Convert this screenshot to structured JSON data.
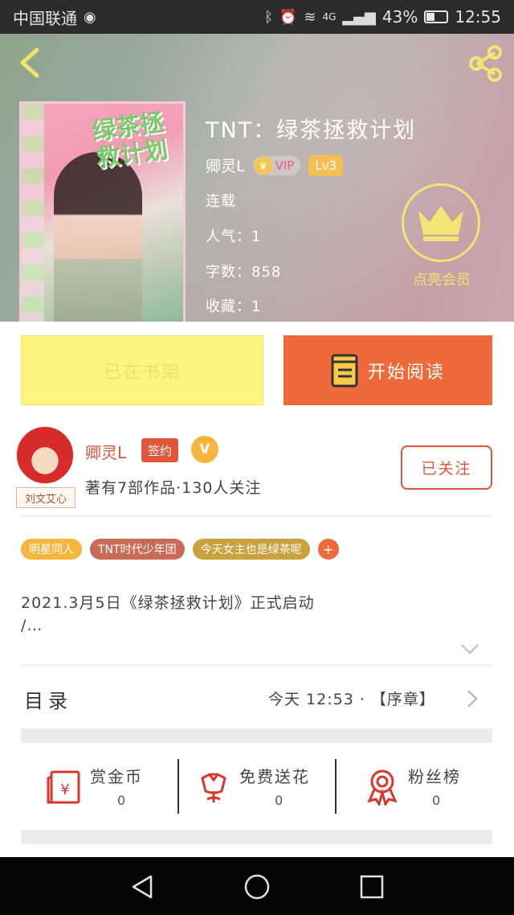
{
  "status_bar": {
    "carrier": "中国联通",
    "network": "4G",
    "battery_text": "43%",
    "battery_level": 0.43,
    "time": "12:55"
  },
  "header": {
    "back_icon": "chevron-left-icon",
    "share_icon": "share-icon"
  },
  "book": {
    "cover_title": "绿茶拯救计划",
    "title": "TNT：绿茶拯救计划",
    "author": "卿灵L",
    "vip_label": "VIP",
    "level_label": "Lv3",
    "status": "连载",
    "popularity_text": "人气：1",
    "word_count_text": "字数：858",
    "favorites_text": "收藏：1"
  },
  "member": {
    "icon": "crown-icon",
    "label": "点亮会员"
  },
  "actions": {
    "shelf_label": "已在书架",
    "read_label": "开始阅读",
    "read_icon": "book-icon"
  },
  "author_card": {
    "name": "卿灵L",
    "sign_badge": "签约",
    "v_badge": "V",
    "avatar_tag": "刘文艾心",
    "stats": "著有7部作品·130人关注",
    "follow_label": "已关注"
  },
  "tags": [
    {
      "label": "明星同人",
      "color": "#f4b63d"
    },
    {
      "label": "TNT时代少年团",
      "color": "#c96b55"
    },
    {
      "label": "今天女主也是绿茶呢",
      "color": "#c9a13d"
    }
  ],
  "tags_more": "+",
  "description": {
    "line1": "2021.3月5日《绿茶拯救计划》正式启动",
    "line2": "/…"
  },
  "catalog": {
    "label": "目录",
    "latest": "今天 12:53 · 【序章】"
  },
  "stats": {
    "bounty_label": "赏金币",
    "bounty_value": "0",
    "flower_label": "免费送花",
    "flower_value": "0",
    "fans_label": "粉丝榜",
    "fans_value": "0"
  },
  "colors": {
    "accent": "#ef6a3a",
    "shelf_yellow": "#fdf57c",
    "member_yellow": "#f2e36a",
    "vip_gold": "#f4b63d"
  }
}
